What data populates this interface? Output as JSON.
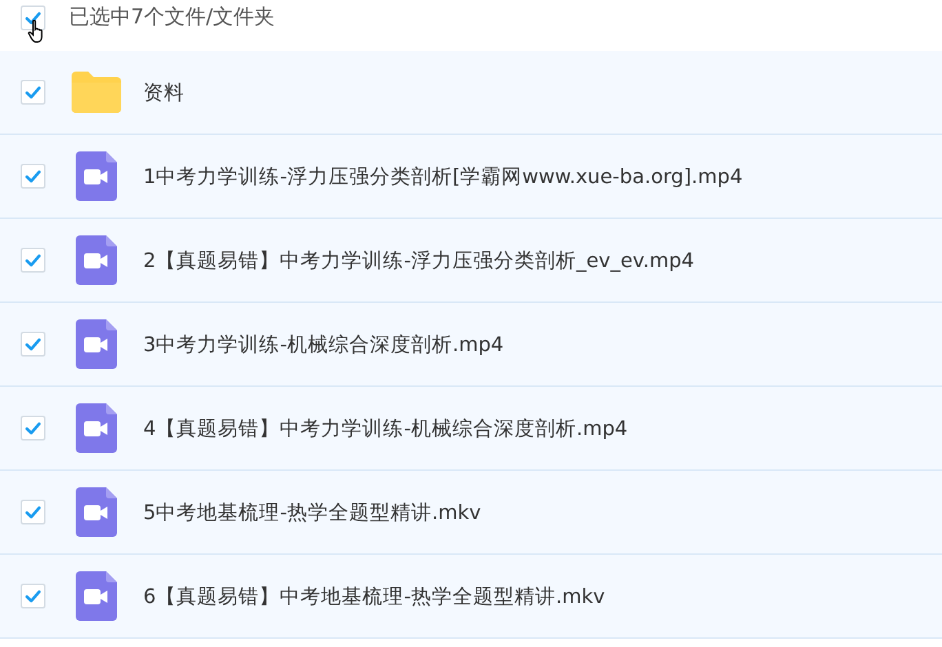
{
  "header": {
    "checked": true,
    "label": "已选中7个文件/文件夹"
  },
  "files": [
    {
      "kind": "folder",
      "name": "资料",
      "checked": true
    },
    {
      "kind": "video",
      "name": "1中考力学训练-浮力压强分类剖析[学霸网www.xue-ba.org].mp4",
      "checked": true
    },
    {
      "kind": "video",
      "name": "2【真题易错】中考力学训练-浮力压强分类剖析_ev_ev.mp4",
      "checked": true
    },
    {
      "kind": "video",
      "name": "3中考力学训练-机械综合深度剖析.mp4",
      "checked": true
    },
    {
      "kind": "video",
      "name": "4【真题易错】中考力学训练-机械综合深度剖析.mp4",
      "checked": true
    },
    {
      "kind": "video",
      "name": "5中考地基梳理-热学全题型精讲.mkv",
      "checked": true
    },
    {
      "kind": "video",
      "name": "6【真题易错】中考地基梳理-热学全题型精讲.mkv",
      "checked": true
    }
  ]
}
